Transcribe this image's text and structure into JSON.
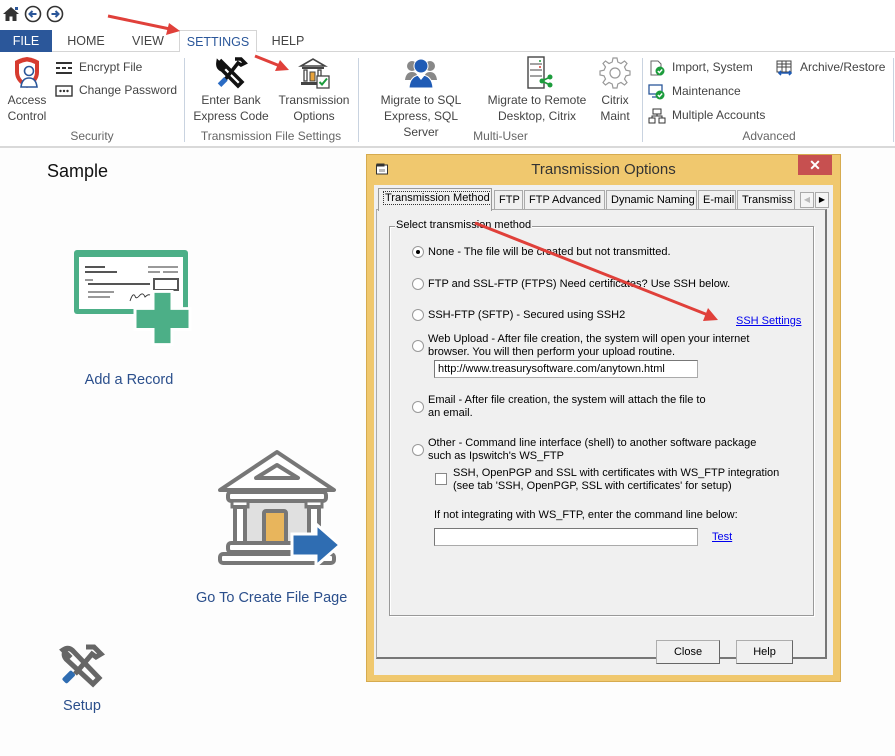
{
  "quick_access": {
    "icons": [
      "home-icon",
      "back-arrow-icon",
      "forward-arrow-icon"
    ]
  },
  "tabs": [
    {
      "label": "FILE",
      "active": false
    },
    {
      "label": "HOME",
      "active": false
    },
    {
      "label": "VIEW",
      "active": false
    },
    {
      "label": "SETTINGS",
      "active": true
    },
    {
      "label": "HELP",
      "active": false
    }
  ],
  "ribbon": {
    "security": {
      "label": "Security",
      "access_control": "Access\nControl",
      "access_control_line1": "Access",
      "access_control_line2": "Control",
      "encrypt_file": "Encrypt File",
      "change_password": "Change Password"
    },
    "transmission": {
      "label": "Transmission File Settings",
      "enter_bank_line1": "Enter Bank",
      "enter_bank_line2": "Express Code",
      "options_line1": "Transmission",
      "options_line2": "Options"
    },
    "multi_user": {
      "label": "Multi-User",
      "sql_line1": "Migrate to SQL",
      "sql_line2": "Express, SQL Server",
      "remote_line1": "Migrate to Remote",
      "remote_line2": "Desktop, Citrix",
      "citrix_line1": "Citrix",
      "citrix_line2": "Maint"
    },
    "advanced": {
      "label": "Advanced",
      "import_system": "Import, System",
      "maintenance": "Maintenance",
      "multiple_accounts": "Multiple Accounts",
      "archive_restore": "Archive/Restore"
    }
  },
  "main": {
    "title": "Sample",
    "tiles": {
      "add_record": "Add a Record",
      "create_file": "Go To Create File Page",
      "setup": "Setup"
    }
  },
  "dialog": {
    "title": "Transmission Options",
    "close_glyph": "✕",
    "tabs": [
      {
        "label": "Transmission Method",
        "active": true
      },
      {
        "label": "FTP",
        "active": false
      },
      {
        "label": "FTP Advanced",
        "active": false
      },
      {
        "label": "Dynamic Naming",
        "active": false
      },
      {
        "label": "E-mail",
        "active": false
      },
      {
        "label": "Transmiss",
        "active": false
      }
    ],
    "scroll_left": "◀",
    "scroll_right": "▶",
    "group_label": "Select transmission method",
    "options": {
      "none": {
        "label": "None - The file will be created but not transmitted.",
        "checked": true
      },
      "ftp": {
        "label": "FTP and SSL-FTP (FTPS) Need certificates? Use SSH below.",
        "checked": false
      },
      "sftp": {
        "label": "SSH-FTP (SFTP) - Secured using SSH2",
        "checked": false
      },
      "web_upload": {
        "line1": "Web Upload - After file creation, the system will open your internet",
        "line2": "browser.  You will then perform your upload routine.",
        "checked": false
      },
      "email": {
        "line1": "Email - After file creation, the system will attach the file to",
        "line2": "an email.",
        "checked": false
      },
      "other": {
        "line1": "Other - Command line interface (shell) to another software package",
        "line2": "such as Ipswitch's WS_FTP",
        "checked": false
      }
    },
    "ssh_settings_link": "SSH Settings",
    "web_url_value": "http://www.treasurysoftware.com/anytown.html",
    "ws_ftp_checkbox": {
      "line1": "SSH, OpenPGP and SSL with certificates with WS_FTP integration",
      "line2": "(see tab 'SSH, OpenPGP, SSL with certificates' for setup)",
      "checked": false
    },
    "command_line_label": "If not integrating with WS_FTP, enter the command line below:",
    "command_line_value": "",
    "test_link": "Test",
    "buttons": {
      "close": "Close",
      "help": "Help"
    }
  },
  "colors": {
    "file_tab": "#2b579a",
    "dialog_frame": "#f0c86e",
    "close_button": "#c75050",
    "tile_text": "#2b4f8c",
    "annotation_arrow": "#e0403a"
  }
}
